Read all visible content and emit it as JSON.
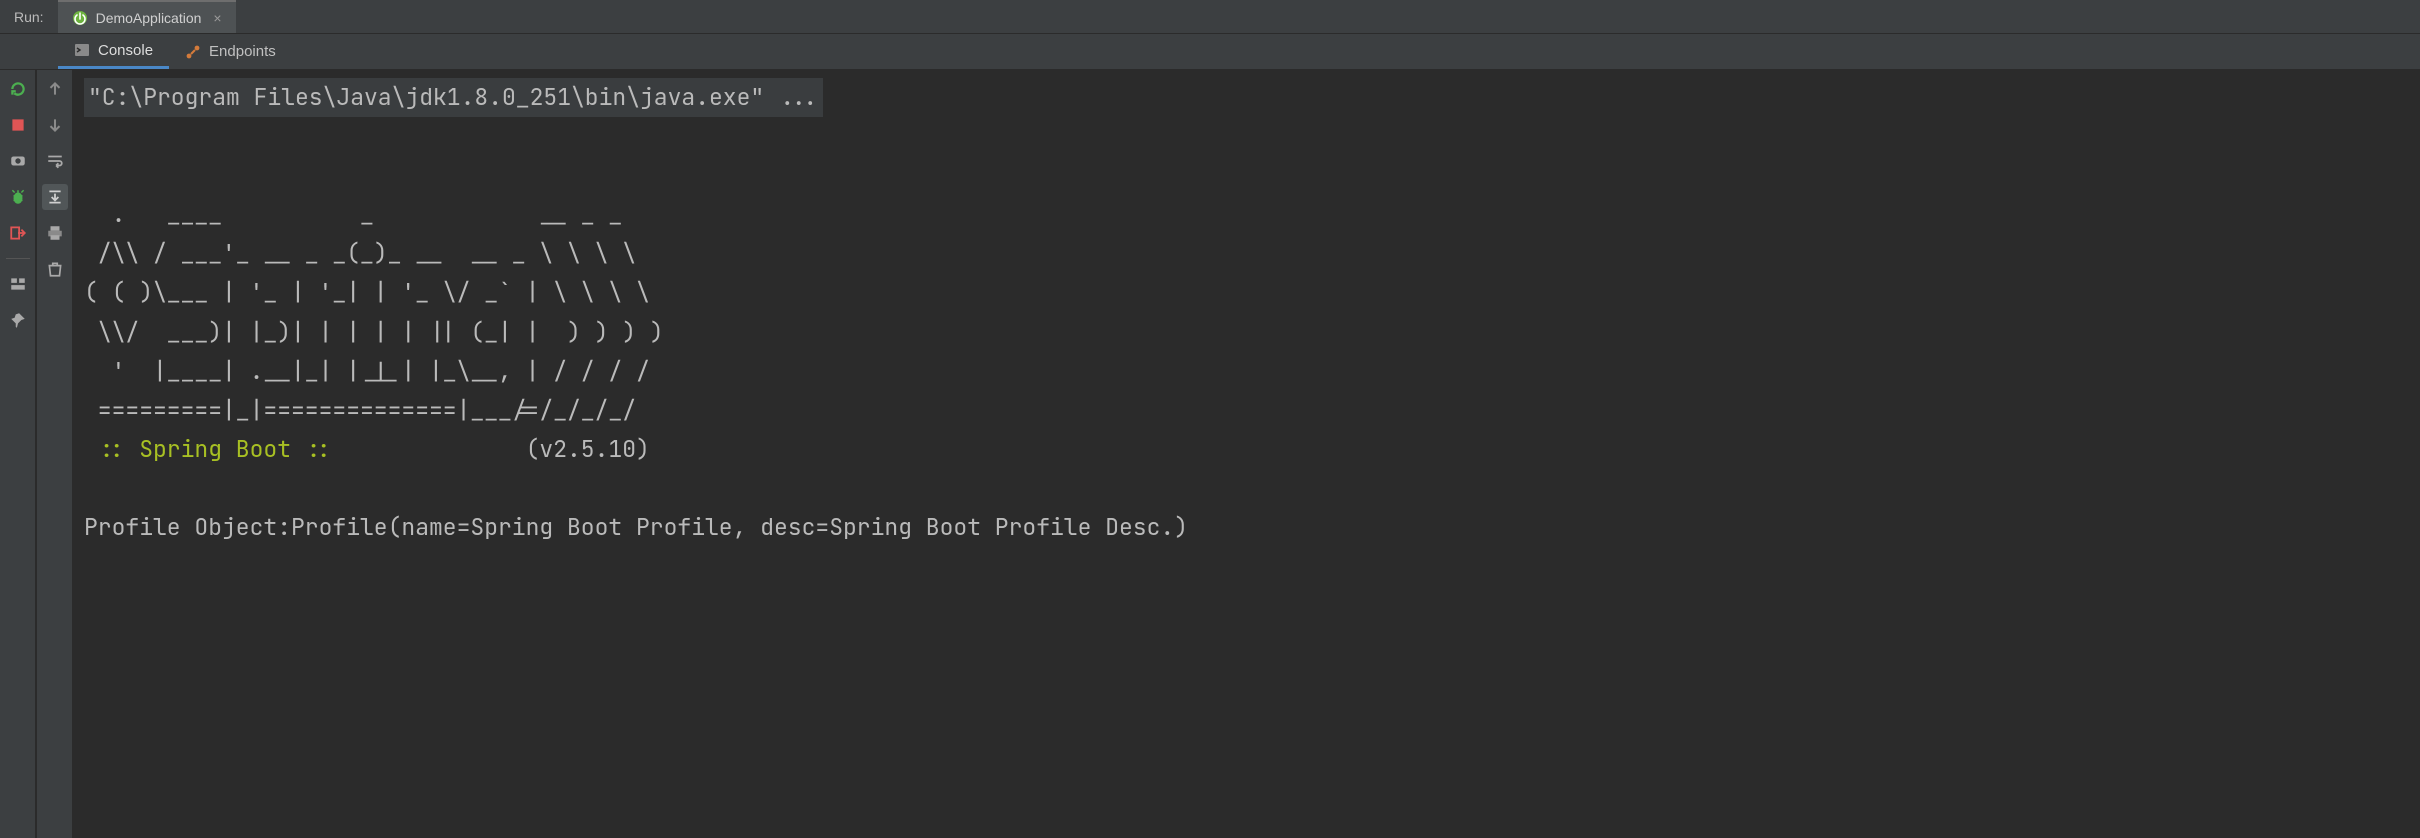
{
  "run_strip": {
    "label": "Run:",
    "config_name": "DemoApplication"
  },
  "tool_tabs": {
    "console": "Console",
    "endpoints": "Endpoints"
  },
  "console": {
    "command": "\"C:\\Program Files\\Java\\jdk1.8.0_251\\bin\\java.exe\" ...",
    "banner_l1": "  .   ____          _            __ _ _",
    "banner_l2": " /\\\\ / ___'_ __ _ _(_)_ __  __ _ \\ \\ \\ \\",
    "banner_l3": "( ( )\\___ | '_ | '_| | '_ \\/ _` | \\ \\ \\ \\",
    "banner_l4": " \\\\/  ___)| |_)| | | | | || (_| |  ) ) ) )",
    "banner_l5": "  '  |____| .__|_| |_|_| |_\\__, | / / / /",
    "banner_l6": " =========|_|==============|___/=/_/_/_/",
    "spring_tag": " :: Spring Boot :: ",
    "version": "             (v2.5.10)",
    "output_line": "Profile Object:Profile(name=Spring Boot Profile, desc=Spring Boot Profile Desc.)"
  }
}
